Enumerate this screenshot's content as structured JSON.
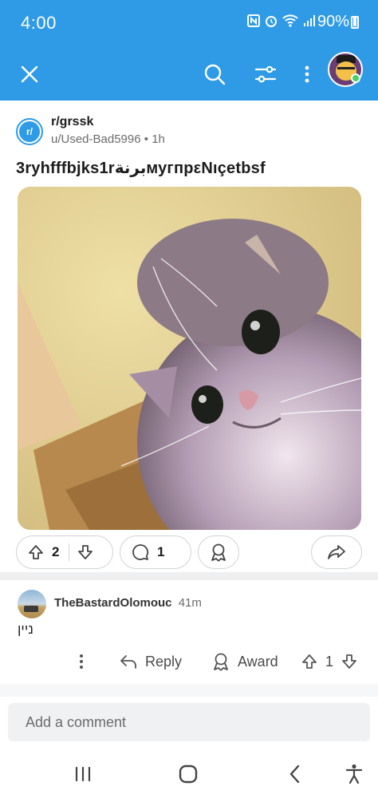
{
  "status_bar": {
    "time": "4:00",
    "battery_text": "90%"
  },
  "app_bar": {
    "icons": [
      "close-icon",
      "search-icon",
      "filter-icon",
      "more-vertical-icon",
      "user-avatar"
    ]
  },
  "post": {
    "subreddit": "r/grssk",
    "subreddit_icon_text": "r/",
    "author": "u/Used-Bad5996",
    "age": "1h",
    "meta_separator": "•",
    "title": "3ryhfffbjks1rبرنةмугпрεNıçetbsf",
    "upvotes": "2",
    "comments": "1"
  },
  "comment": {
    "author": "TheBastardOlomouc",
    "age": "41m",
    "body": "ניין",
    "reply_label": "Reply",
    "award_label": "Award",
    "score": "1"
  },
  "composer": {
    "placeholder": "Add a comment"
  },
  "colors": {
    "accent": "#2f9be6",
    "online": "#46d160"
  }
}
